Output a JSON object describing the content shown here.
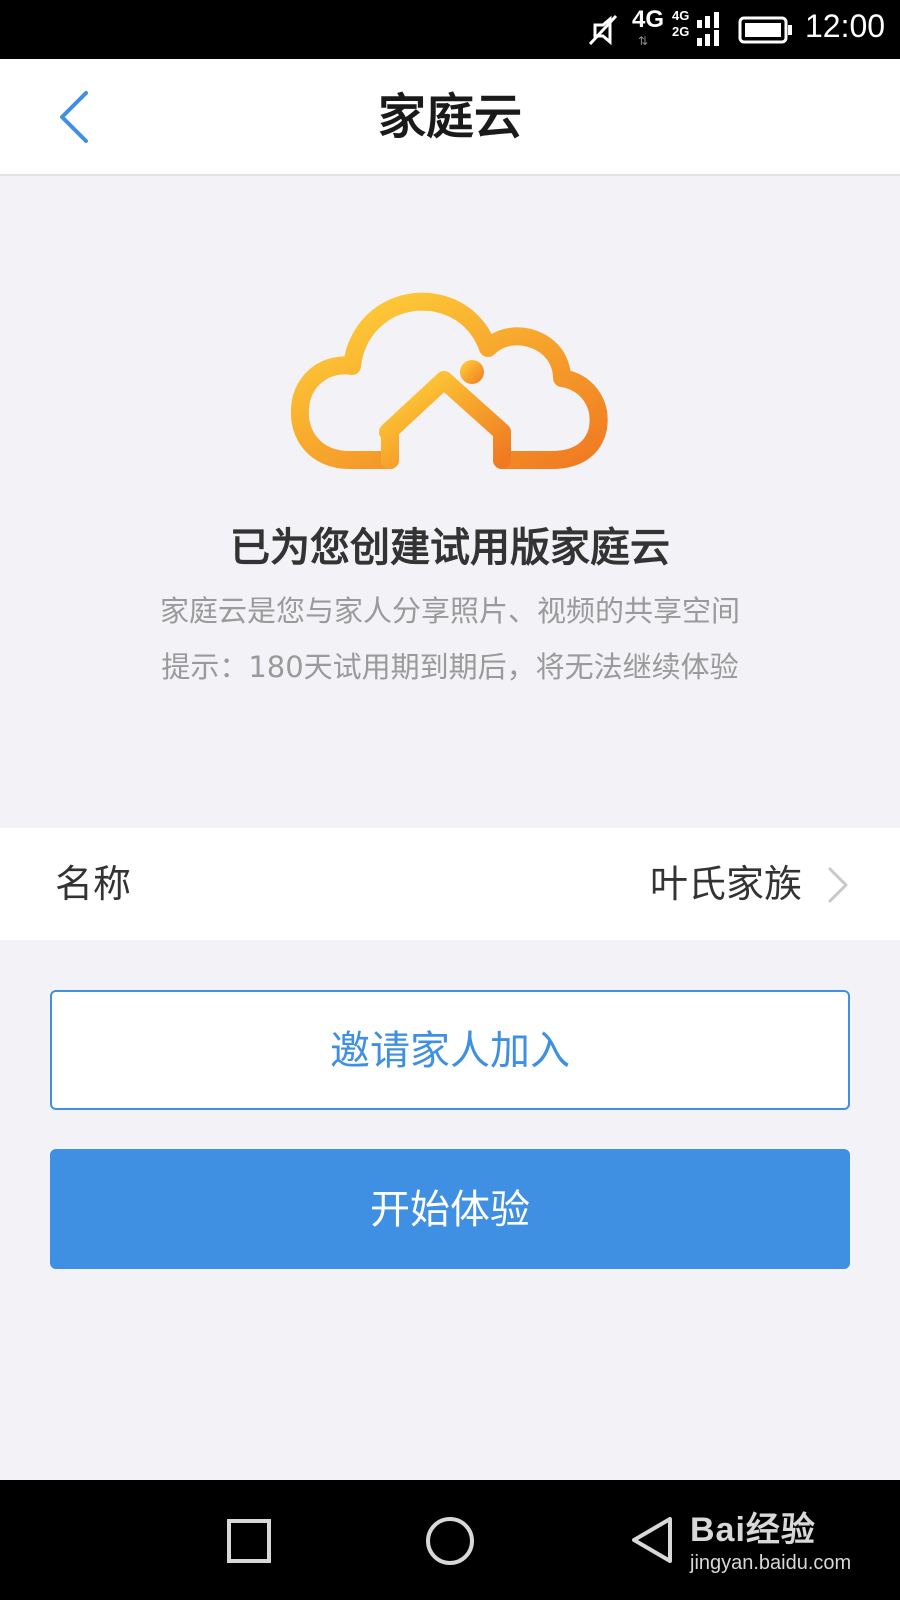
{
  "status_bar": {
    "network": "4G",
    "network_dual_top": "4G",
    "network_dual_bottom": "2G",
    "time": "12:00"
  },
  "header": {
    "title": "家庭云"
  },
  "main": {
    "headline": "已为您创建试用版家庭云",
    "description": "家庭云是您与家人分享照片、视频的共享空间",
    "tip": "提示：180天试用期到期后，将无法继续体验"
  },
  "name_row": {
    "label": "名称",
    "value": "叶氏家族"
  },
  "buttons": {
    "invite": "邀请家人加入",
    "start": "开始体验"
  },
  "watermark": {
    "brand": "Bai经验",
    "url": "jingyan.baidu.com"
  },
  "icons": {
    "back": "chevron-left",
    "logo": "cloud-house",
    "row_arrow": "chevron-right",
    "nav_recent": "square",
    "nav_home": "circle",
    "nav_back": "triangle-left"
  },
  "colors": {
    "accent": "#3f8fe2",
    "background": "#f3f2f6",
    "logo_start": "#ffd43b",
    "logo_end": "#f07a22"
  }
}
